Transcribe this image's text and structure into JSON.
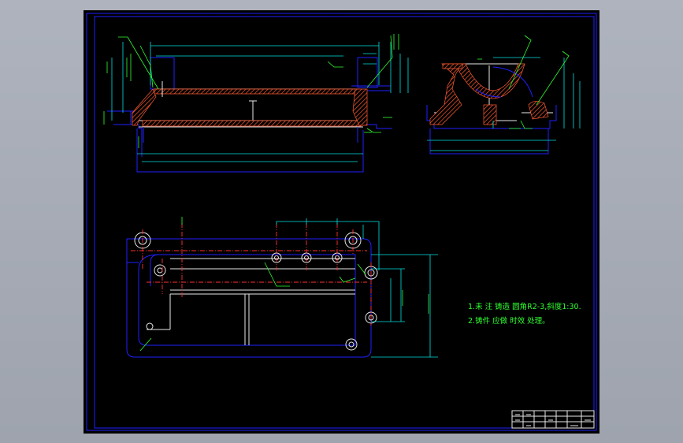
{
  "drawing": {
    "notes": [
      "1.未 注 铸造 圆角R2-3,斜度1:30.",
      "2.铸件 应做 时效 处理。"
    ],
    "colors": {
      "background": "#000000",
      "outline": "#2020ff",
      "dimension": "#00e0e0",
      "annotation": "#30ff30",
      "centerline": "#ff3030",
      "section_hatch": "#ff5a30"
    }
  }
}
